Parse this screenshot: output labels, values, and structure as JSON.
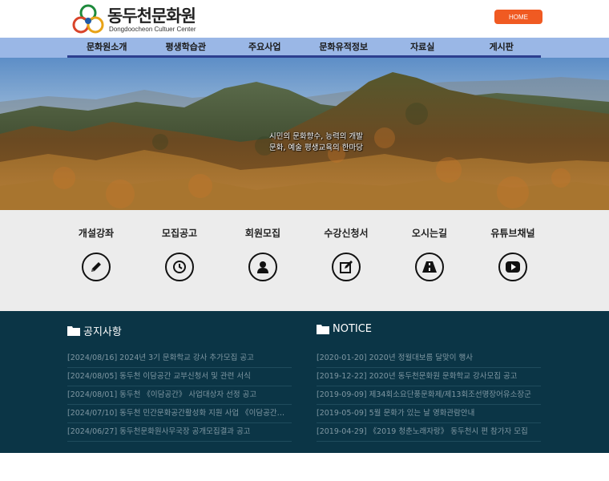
{
  "header": {
    "logo_title": "동두천문화원",
    "logo_sub": "Dongdoocheon Cultuer Center",
    "home_label": "HOME"
  },
  "nav": {
    "items": [
      {
        "label": "문화원소개"
      },
      {
        "label": "평생학습관"
      },
      {
        "label": "주요사업"
      },
      {
        "label": "문화유적정보"
      },
      {
        "label": "자료실"
      },
      {
        "label": "게시판"
      }
    ]
  },
  "hero": {
    "line1": "시민의 문화향수, 능력의 개발",
    "line2": "문화, 예술 평생교육의 한마당"
  },
  "quick": {
    "items": [
      {
        "label": "개설강좌",
        "icon": "pencil-icon"
      },
      {
        "label": "모집공고",
        "icon": "clock-icon"
      },
      {
        "label": "회원모집",
        "icon": "user-icon"
      },
      {
        "label": "수강신청서",
        "icon": "edit-icon"
      },
      {
        "label": "오시는길",
        "icon": "road-icon"
      },
      {
        "label": "유튜브채널",
        "icon": "youtube-icon"
      }
    ]
  },
  "notice_kr": {
    "title": "공지사항",
    "items": [
      "[2024/08/16] 2024년 3기 문화학교 강사 추가모집 공고",
      "[2024/08/05] 동두천 이담공간 교부신청서 및 관련 서식",
      "[2024/08/01] 동두천 《이담공간》 사업대상자 선정 공고",
      "[2024/07/10] 동두천 민간문화공간활성화 지원 사업 《이담공간》 ...",
      "[2024/06/27] 동두천문화원사무국장 공개모집결과 공고"
    ]
  },
  "notice_en": {
    "title": "NOTICE",
    "items": [
      "[2020-01-20] 2020년 정월대보름 달맞이 행사",
      "[2019-12-22] 2020년 동두천문화원 문화학교 강사모집 공고",
      "[2019-09-09] 제34회소요단풍문화제/제13회조선명장어유소장군",
      "[2019-05-09] 5월 문화가 있는 날 영화관람안내",
      "[2019-04-29] 《2019 청춘노래자랑》 동두천시 편 참가자 모집"
    ]
  },
  "colors": {
    "home_button": "#f05a22",
    "nav_bg": "#9ab7e6",
    "nav_underline": "#2d3f8f",
    "quick_bg": "#ececec",
    "notice_bg": "#0b3546"
  }
}
